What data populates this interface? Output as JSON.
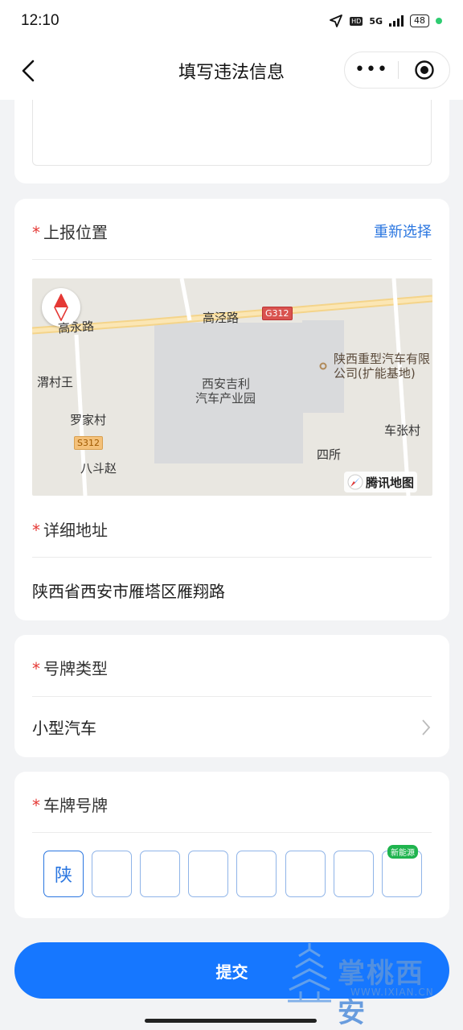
{
  "status_bar": {
    "time": "12:10",
    "network": "5G",
    "battery": "48"
  },
  "nav": {
    "title": "填写违法信息",
    "more_label": "•••"
  },
  "location": {
    "title": "上报位置",
    "required_mark": "*",
    "reselect_label": "重新选择",
    "map": {
      "provider": "腾讯地图",
      "labels": {
        "road1": "高永路",
        "road2": "高泾路",
        "g312": "G312",
        "s312": "S312",
        "park_line1": "西安吉利",
        "park_line2": "汽车产业园",
        "company_line1": "陕西重型汽车有限",
        "company_line2": "公司(扩能基地)",
        "village1": "渭村王",
        "village2": "罗家村",
        "village3": "八斗赵",
        "village4": "车张村",
        "place1": "四所"
      }
    }
  },
  "address": {
    "title": "详细地址",
    "required_mark": "*",
    "value": "陕西省西安市雁塔区雁翔路"
  },
  "plate_type": {
    "title": "号牌类型",
    "required_mark": "*",
    "value": "小型汽车"
  },
  "plate_number": {
    "title": "车牌号牌",
    "required_mark": "*",
    "chars": [
      "陕",
      "",
      "",
      "",
      "",
      "",
      "",
      ""
    ],
    "nev_badge": "新能源"
  },
  "submit_label": "提交",
  "watermark": {
    "text": "掌桃西安",
    "url": "WWW.IXIAN.CN"
  },
  "colors": {
    "accent": "#1677ff",
    "link": "#2a76e0",
    "required": "#e53935",
    "badge": "#1fb44e"
  }
}
